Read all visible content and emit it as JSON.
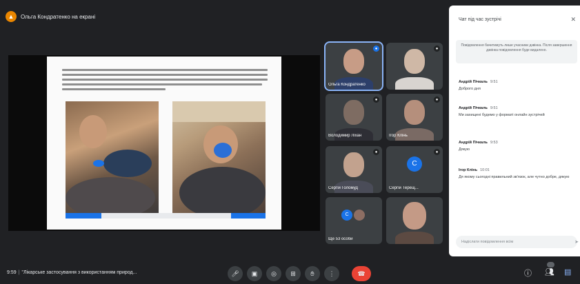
{
  "banner": {
    "text": "Ольга Кондратенко на екрані"
  },
  "chat": {
    "title": "Чат під час зустрічі",
    "close_icon": "close-icon",
    "notice": "Повідомлення бачитимуть лише учасники дзвінка. Після завершення дзвінка повідомлення буде видалено.",
    "messages": [
      {
        "author": "Андрій Пічкаль",
        "time": "9:51",
        "text": "Доброго дня"
      },
      {
        "author": "Андрій Пічкаль",
        "time": "9:51",
        "text": "Ми захищені будемо у форматі онлайн зустрічей"
      },
      {
        "author": "Андрій Пічкаль",
        "time": "9:53",
        "text": "Дякую"
      },
      {
        "author": "Ігор Клінь",
        "time": "10:01",
        "text": "Дя якому сьогодні правильний зв'язок, але чутно добре, дякую"
      }
    ],
    "input_placeholder": "Надіслати повідомлення всім"
  },
  "tiles": [
    {
      "name": "Ольга Кондратенко",
      "mic": "●"
    },
    {
      "name": "",
      "mic": "●"
    },
    {
      "name": "Володимир Ліхан",
      "mic": "●"
    },
    {
      "name": "Ігор Клінь",
      "mic": "●"
    },
    {
      "name": "Сергій Голомуд",
      "mic": "●"
    },
    {
      "name": "Сергій Терещ...",
      "mic": "●"
    },
    {
      "name": "Ще 53 особи",
      "mic": ""
    },
    {
      "name": "",
      "mic": ""
    }
  ],
  "avatars": {
    "tile5": "C",
    "tile6": "C"
  },
  "bottom": {
    "time": "9:59",
    "meeting_title": "\"Лікарське застосування з використанням природ..."
  },
  "colors": {
    "accent": "#1a73e8",
    "end_call": "#ea4335",
    "present": "#ea8600"
  }
}
